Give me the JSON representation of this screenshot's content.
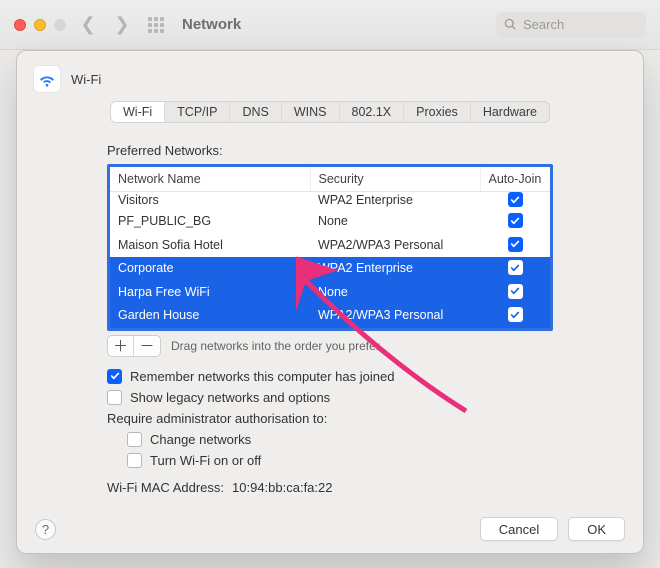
{
  "window": {
    "title": "Network",
    "search_placeholder": "Search"
  },
  "sheet": {
    "title": "Wi-Fi",
    "tabs": [
      "Wi-Fi",
      "TCP/IP",
      "DNS",
      "WINS",
      "802.1X",
      "Proxies",
      "Hardware"
    ],
    "active_tab": 0,
    "section_label": "Preferred Networks:",
    "table_headers": {
      "name": "Network Name",
      "security": "Security",
      "autojoin": "Auto-Join"
    },
    "networks": [
      {
        "name": "Visitors",
        "security": "WPA2 Enterprise",
        "autojoin": true,
        "selected": false,
        "cut": true
      },
      {
        "name": "PF_PUBLIC_BG",
        "security": "None",
        "autojoin": true,
        "selected": false
      },
      {
        "name": "Maison Sofia Hotel",
        "security": "WPA2/WPA3 Personal",
        "autojoin": true,
        "selected": false
      },
      {
        "name": "Corporate",
        "security": "WPA2 Enterprise",
        "autojoin": true,
        "selected": true
      },
      {
        "name": "Harpa Free WiFi",
        "security": "None",
        "autojoin": true,
        "selected": true
      },
      {
        "name": "Garden House",
        "security": "WPA2/WPA3 Personal",
        "autojoin": true,
        "selected": true
      }
    ],
    "drag_hint": "Drag networks into the order you prefer.",
    "remember_label": "Remember networks this computer has joined",
    "remember_checked": true,
    "legacy_label": "Show legacy networks and options",
    "legacy_checked": false,
    "admin_label": "Require administrator authorisation to:",
    "admin_change_label": "Change networks",
    "admin_change_checked": false,
    "admin_wifi_label": "Turn Wi-Fi on or off",
    "admin_wifi_checked": false,
    "mac_label": "Wi-Fi MAC Address:",
    "mac_value": "10:94:bb:ca:fa:22",
    "cancel": "Cancel",
    "ok": "OK",
    "help": "?"
  },
  "colors": {
    "accent": "#0a60ff",
    "selection": "#1a62e6",
    "arrow": "#ea2f7a"
  }
}
